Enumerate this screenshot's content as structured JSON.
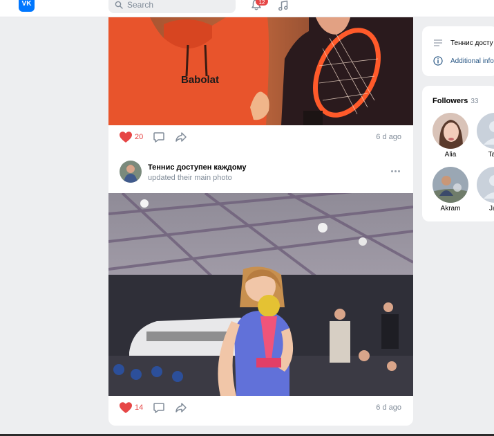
{
  "header": {
    "logo_text": "VK",
    "search_placeholder": "Search",
    "notifications_badge": "12"
  },
  "posts": [
    {
      "likes": "20",
      "time": "6 d ago",
      "brand_text": "Babolat"
    },
    {
      "author": "Теннис доступен каждому",
      "subline": "updated their main photo",
      "likes": "14",
      "time": "6 d ago"
    }
  ],
  "info": {
    "name": "Теннис досту",
    "additional": "Additional info"
  },
  "followers": {
    "title": "Followers",
    "count": "33",
    "items": [
      {
        "name": "Alia"
      },
      {
        "name": "Tam"
      },
      {
        "name": "Akram"
      },
      {
        "name": "Jab"
      }
    ]
  },
  "colors": {
    "accent": "#0077ff",
    "like": "#e64646",
    "link": "#2a5885",
    "muted": "#818c99"
  }
}
